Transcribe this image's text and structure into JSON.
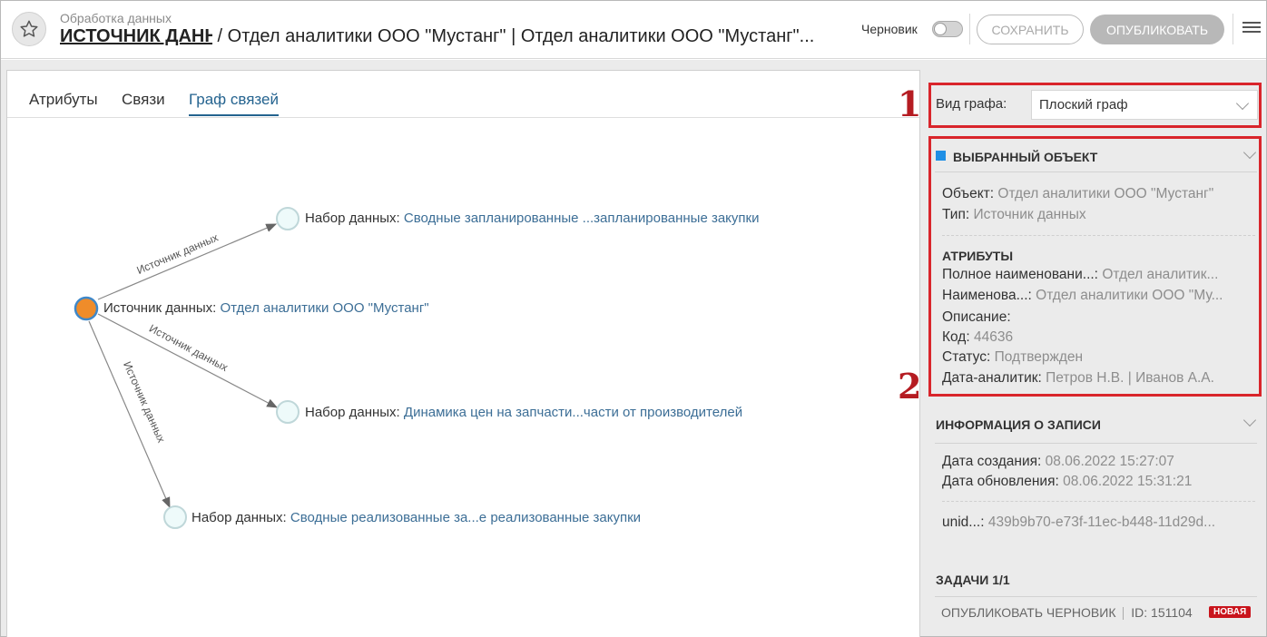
{
  "header": {
    "subtitle": "Обработка данных",
    "source_link": "ИСТОЧНИК ДАННЫХ",
    "title_rest": " / Отдел аналитики ООО \"Мустанг\" | Отдел аналитики ООО \"Мустанг\"...",
    "draft_label": "Черновик",
    "save_label": "СОХРАНИТЬ",
    "publish_label": "ОПУБЛИКОВАТЬ"
  },
  "tabs": [
    "Атрибуты",
    "Связи",
    "Граф связей"
  ],
  "graph": {
    "center": {
      "prefix": "Источник данных:",
      "link": "Отдел аналитики ООО \"Мустанг\""
    },
    "nodes": [
      {
        "prefix": "Набор данных:",
        "link": "Сводные запланированные ...запланированные закупки"
      },
      {
        "prefix": "Набор данных:",
        "link": "Динамика цен на запчасти...части от производителей"
      },
      {
        "prefix": "Набор данных:",
        "link": "Сводные реализованные за...е реализованные закупки"
      }
    ],
    "edge_label": "Источник данных"
  },
  "side": {
    "graph_type_label": "Вид графа:",
    "graph_type_value": "Плоский граф",
    "annotation_1": "1",
    "annotation_2": "2",
    "selected": {
      "title": "ВЫБРАННЫЙ ОБЪЕКТ",
      "object_key": "Объект:",
      "object_val": "Отдел аналитики ООО \"Мустанг\"",
      "type_key": "Тип:",
      "type_val": "Источник данных",
      "attrs_title": "АТРИБУТЫ",
      "full_name_key": "Полное наименовани...:",
      "full_name_val": "Отдел аналитик...",
      "name_key": "Наименова...:",
      "name_val": "Отдел аналитики ООО \"Му...",
      "desc_key": "Описание:",
      "code_key": "Код:",
      "code_val": "44636",
      "status_key": "Статус:",
      "status_val": "Подтвержден",
      "analyst_key": "Дата-аналитик:",
      "analyst_val": "Петров Н.В. | Иванов А.А."
    },
    "info": {
      "title": "ИНФОРМАЦИЯ О ЗАПИСИ",
      "created_key": "Дата создания:",
      "created_val": "08.06.2022 15:27:07",
      "updated_key": "Дата обновления:",
      "updated_val": "08.06.2022 15:31:21",
      "unid_key": "unid...:",
      "unid_val": "439b9b70-e73f-11ec-b448-11d29d..."
    },
    "tasks": {
      "title": "ЗАДАЧИ 1/1",
      "task_name": "ОПУБЛИКОВАТЬ ЧЕРНОВИК",
      "task_id": "ID: 151104",
      "badge": "НОВАЯ"
    }
  },
  "colors": {
    "accent": "#24638f",
    "link": "#3c6e96",
    "center_node": "#ef8c2a",
    "leaf_node": "#eefafa",
    "annotation_red": "#d9252b",
    "badge_red": "#c9141c"
  }
}
